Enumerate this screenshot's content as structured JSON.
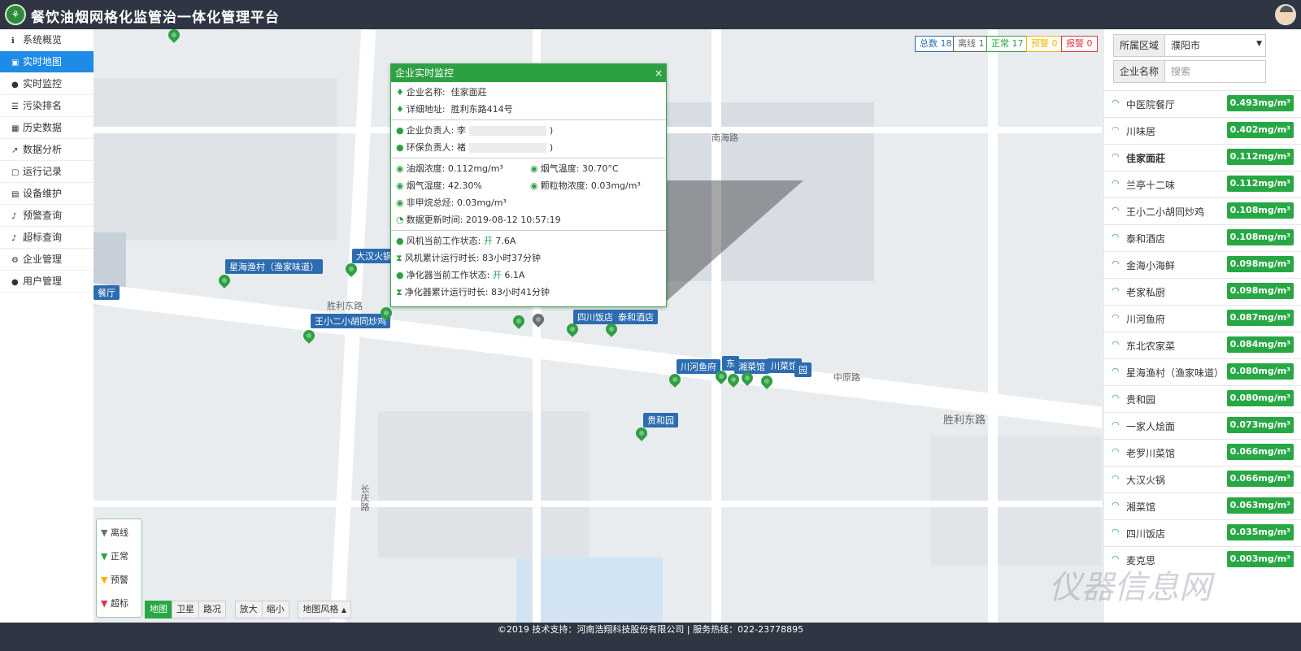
{
  "header": {
    "title": "餐饮油烟网格化监管治一体化管理平台"
  },
  "sidebar": {
    "items": [
      {
        "label": "系统概览",
        "icon": "info-icon"
      },
      {
        "label": "实时地图",
        "icon": "map-icon",
        "active": true
      },
      {
        "label": "实时监控",
        "icon": "tint-icon"
      },
      {
        "label": "污染排名",
        "icon": "list-icon"
      },
      {
        "label": "历史数据",
        "icon": "table-icon"
      },
      {
        "label": "数据分析",
        "icon": "chart-icon"
      },
      {
        "label": "运行记录",
        "icon": "file-icon"
      },
      {
        "label": "设备维护",
        "icon": "doc-icon"
      },
      {
        "label": "预警查询",
        "icon": "bell-icon"
      },
      {
        "label": "超标查询",
        "icon": "bell-icon"
      },
      {
        "label": "企业管理",
        "icon": "gear-icon"
      },
      {
        "label": "用户管理",
        "icon": "user-icon"
      }
    ]
  },
  "stats": {
    "total_label": "总数",
    "total": "18",
    "offline_label": "离线",
    "offline": "1",
    "normal_label": "正常",
    "normal": "17",
    "warning_label": "预警",
    "warning": "0",
    "alarm_label": "报警",
    "alarm": "0"
  },
  "popup": {
    "title": "企业实时监控",
    "company_label": "企业名称:",
    "company": "佳家面莊",
    "address_label": "详细地址:",
    "address": "胜利东路414号",
    "owner_label": "企业负责人:",
    "owner_visible": "李",
    "owner_suffix": ")",
    "env_label": "环保负责人:",
    "env_visible": "褚",
    "env_suffix": ")",
    "smoke_label": "油烟浓度:",
    "smoke": "0.112mg/m³",
    "temp_label": "烟气温度:",
    "temp": "30.70°C",
    "humidity_label": "烟气湿度:",
    "humidity": "42.30%",
    "particle_label": "颗粒物浓度:",
    "particle": "0.03mg/m³",
    "nmhc_label": "非甲烷总烃:",
    "nmhc": "0.03mg/m³",
    "update_label": "数据更新时间:",
    "update": "2019-08-12 10:57:19",
    "fan_state_label": "风机当前工作状态:",
    "fan_state": "开",
    "fan_current": "7.6A",
    "fan_run_label": "风机累计运行时长:",
    "fan_run": "83小时37分钟",
    "purifier_state_label": "净化器当前工作状态:",
    "purifier_state": "开",
    "purifier_current": "6.1A",
    "purifier_run_label": "净化器累计运行时长:",
    "purifier_run": "83小时41分钟"
  },
  "legend": {
    "offline": "离线",
    "normal": "正常",
    "warning": "预警",
    "exceed": "超标"
  },
  "map_controls": {
    "map": "地图",
    "satellite": "卫星",
    "traffic": "路况",
    "zoom_in": "放大",
    "zoom_out": "缩小",
    "style": "地图风格"
  },
  "map_labels": {
    "xingai": "星海渔村（渔家味道）",
    "dahan": "大汉火锅",
    "wangxiaoer": "王小二小胡同炒鸡",
    "sichuan": "四川饭店",
    "taihe": "泰和酒店",
    "chuanhe": "川河鱼府",
    "dong": "东",
    "xiangcai": "湘菜馆",
    "chuancai": "川菜馆",
    "guihe": "贵和园",
    "canting": "餐厅",
    "hui": "园",
    "road_shengli1": "胜利东路",
    "road_shengli2": "胜利东路",
    "road_nanhai": "南海路",
    "road_zhongyuan": "中原路",
    "road_changqing": "长庆路"
  },
  "right": {
    "region_label": "所属区域",
    "region_value": "濮阳市",
    "company_label": "企业名称",
    "search_placeholder": "搜索",
    "list": [
      {
        "name": "中医院餐厅",
        "value": "0.493mg/m³",
        "offline": false
      },
      {
        "name": "川味居",
        "value": "0.402mg/m³",
        "offline": true
      },
      {
        "name": "佳家面莊",
        "value": "0.112mg/m³",
        "offline": false,
        "selected": true
      },
      {
        "name": "兰亭十二味",
        "value": "0.112mg/m³",
        "offline": false
      },
      {
        "name": "王小二小胡同炒鸡",
        "value": "0.108mg/m³",
        "offline": false
      },
      {
        "name": "泰和酒店",
        "value": "0.108mg/m³",
        "offline": false
      },
      {
        "name": "金海小海鲜",
        "value": "0.098mg/m³",
        "offline": false
      },
      {
        "name": "老家私厨",
        "value": "0.098mg/m³",
        "offline": false
      },
      {
        "name": "川河鱼府",
        "value": "0.087mg/m³",
        "offline": false
      },
      {
        "name": "东北农家菜",
        "value": "0.084mg/m³",
        "offline": false
      },
      {
        "name": "星海渔村（渔家味道）",
        "value": "0.080mg/m³",
        "offline": false
      },
      {
        "name": "贵和园",
        "value": "0.080mg/m³",
        "offline": false
      },
      {
        "name": "一家人烩面",
        "value": "0.073mg/m³",
        "offline": false
      },
      {
        "name": "老罗川菜馆",
        "value": "0.066mg/m³",
        "offline": false
      },
      {
        "name": "大汉火锅",
        "value": "0.066mg/m³",
        "offline": false
      },
      {
        "name": "湘菜馆",
        "value": "0.063mg/m³",
        "offline": false
      },
      {
        "name": "四川饭店",
        "value": "0.035mg/m³",
        "offline": false
      },
      {
        "name": "麦克思",
        "value": "0.003mg/m³",
        "offline": false
      }
    ]
  },
  "footer": {
    "text": "©2019 技术支持：河南浩翔科技股份有限公司 | 服务热线：022-23778895"
  },
  "watermark": "仪器信息网",
  "colors": {
    "header_bg": "#2f3543",
    "active_nav": "#1e8be6",
    "normal": "#2ea044",
    "offline": "#6b6f75",
    "warning": "#f5b400",
    "exceed": "#e0364a"
  }
}
